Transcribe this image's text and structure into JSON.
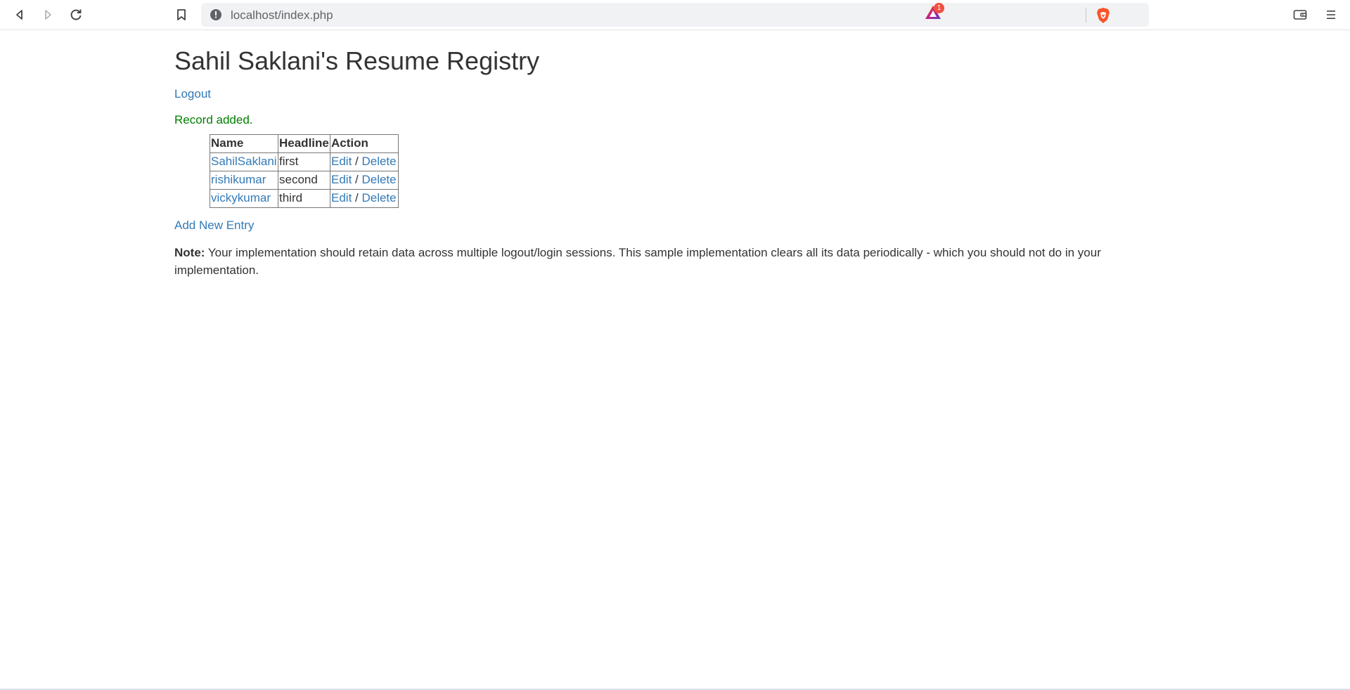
{
  "browser": {
    "url": "localhost/index.php",
    "rewards_badge": "1",
    "accent_color": "#ef5140"
  },
  "page": {
    "title": "Sahil Saklani's Resume Registry",
    "logout_label": "Logout",
    "flash_message": "Record added.",
    "flash_color": "#008000",
    "link_color": "#337ab7",
    "table": {
      "headers": [
        "Name",
        "Headline",
        "Action"
      ],
      "rows": [
        {
          "name": "SahilSaklani",
          "headline": "first",
          "edit": "Edit",
          "sep": " / ",
          "delete": "Delete"
        },
        {
          "name": "rishikumar",
          "headline": "second",
          "edit": "Edit",
          "sep": " / ",
          "delete": "Delete"
        },
        {
          "name": "vickykumar",
          "headline": "third",
          "edit": "Edit",
          "sep": " / ",
          "delete": "Delete"
        }
      ]
    },
    "add_entry_label": "Add New Entry",
    "note_label": "Note:",
    "note_text": " Your implementation should retain data across multiple logout/login sessions. This sample implementation clears all its data periodically - which you should not do in your implementation."
  }
}
